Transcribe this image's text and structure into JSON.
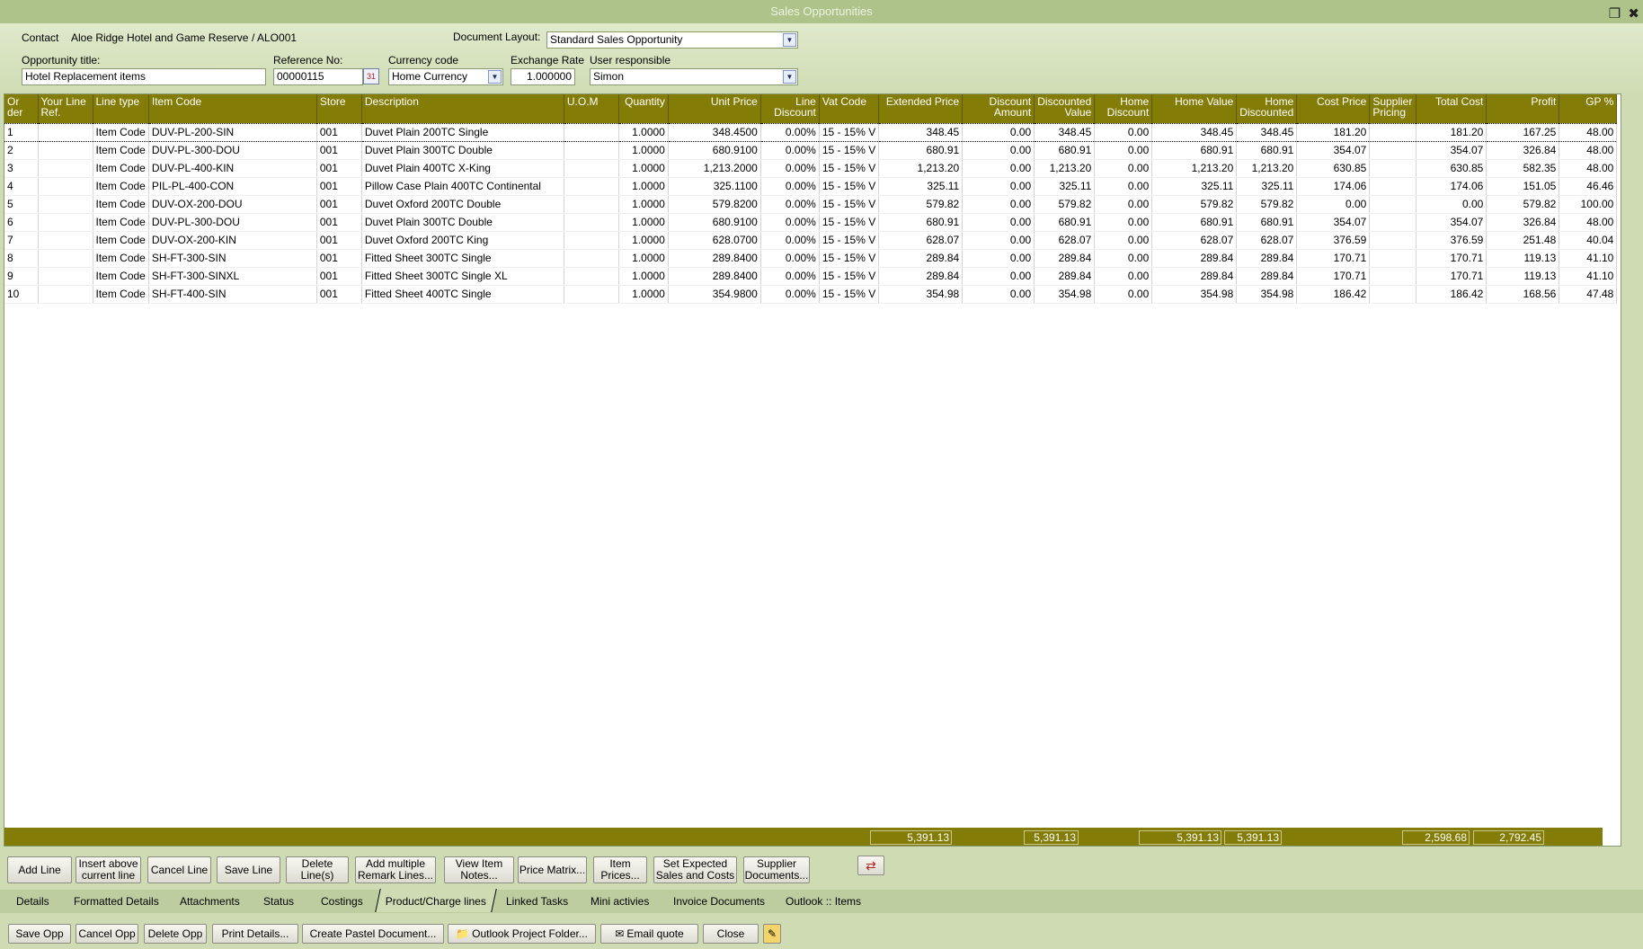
{
  "window": {
    "title": "Sales Opportunities",
    "restore_glyph": "❐",
    "close_glyph": "✖"
  },
  "header": {
    "contact_label": "Contact",
    "contact_name": "Aloe Ridge Hotel and Game Reserve",
    "contact_code": "/ ALO001",
    "document_layout_label": "Document Layout:",
    "document_layout_value": "Standard Sales Opportunity",
    "opportunity_title_label": "Opportunity title:",
    "opportunity_title_value": "Hotel Replacement items",
    "reference_label": "Reference No:",
    "reference_value": "00000115",
    "currency_label": "Currency code",
    "currency_value": "Home Currency",
    "exchange_rate_label": "Exchange Rate",
    "exchange_rate_value": "1.000000",
    "user_label": "User responsible",
    "user_value": "Simon"
  },
  "grid": {
    "columns": [
      {
        "label": "Or der",
        "align": "l"
      },
      {
        "label": "Your Line Ref.",
        "align": "l"
      },
      {
        "label": "Line type",
        "align": "l"
      },
      {
        "label": "Item Code",
        "align": "l"
      },
      {
        "label": "Store",
        "align": "l"
      },
      {
        "label": "Description",
        "align": "l"
      },
      {
        "label": "U.O.M",
        "align": "l"
      },
      {
        "label": "Quantity",
        "align": "r"
      },
      {
        "label": "Unit Price",
        "align": "r"
      },
      {
        "label": "Line Discount",
        "align": "r"
      },
      {
        "label": "Vat Code",
        "align": "l"
      },
      {
        "label": "Extended Price",
        "align": "r"
      },
      {
        "label": "Discount Amount",
        "align": "r"
      },
      {
        "label": "Discounted Value",
        "align": "r"
      },
      {
        "label": "Home Discount",
        "align": "r"
      },
      {
        "label": "Home Value",
        "align": "r"
      },
      {
        "label": "Home Discounted",
        "align": "r"
      },
      {
        "label": "Cost Price",
        "align": "r"
      },
      {
        "label": "Supplier Pricing",
        "align": "l"
      },
      {
        "label": "Total Cost",
        "align": "r"
      },
      {
        "label": "Profit",
        "align": "r"
      },
      {
        "label": "GP %",
        "align": "r"
      }
    ],
    "rows": [
      [
        "1",
        "",
        "Item Code",
        "DUV-PL-200-SIN",
        "001",
        "Duvet Plain 200TC Single",
        "",
        "1.0000",
        "348.4500",
        "0.00%",
        "15 - 15% V",
        "348.45",
        "0.00",
        "348.45",
        "0.00",
        "348.45",
        "348.45",
        "181.20",
        "",
        "181.20",
        "167.25",
        "48.00"
      ],
      [
        "2",
        "",
        "Item Code",
        "DUV-PL-300-DOU",
        "001",
        "Duvet Plain 300TC Double",
        "",
        "1.0000",
        "680.9100",
        "0.00%",
        "15 - 15% V",
        "680.91",
        "0.00",
        "680.91",
        "0.00",
        "680.91",
        "680.91",
        "354.07",
        "",
        "354.07",
        "326.84",
        "48.00"
      ],
      [
        "3",
        "",
        "Item Code",
        "DUV-PL-400-KIN",
        "001",
        "Duvet Plain 400TC X-King",
        "",
        "1.0000",
        "1,213.2000",
        "0.00%",
        "15 - 15% V",
        "1,213.20",
        "0.00",
        "1,213.20",
        "0.00",
        "1,213.20",
        "1,213.20",
        "630.85",
        "",
        "630.85",
        "582.35",
        "48.00"
      ],
      [
        "4",
        "",
        "Item Code",
        "PIL-PL-400-CON",
        "001",
        "Pillow Case Plain 400TC Continental",
        "",
        "1.0000",
        "325.1100",
        "0.00%",
        "15 - 15% V",
        "325.11",
        "0.00",
        "325.11",
        "0.00",
        "325.11",
        "325.11",
        "174.06",
        "",
        "174.06",
        "151.05",
        "46.46"
      ],
      [
        "5",
        "",
        "Item Code",
        "DUV-OX-200-DOU",
        "001",
        "Duvet Oxford 200TC Double",
        "",
        "1.0000",
        "579.8200",
        "0.00%",
        "15 - 15% V",
        "579.82",
        "0.00",
        "579.82",
        "0.00",
        "579.82",
        "579.82",
        "0.00",
        "",
        "0.00",
        "579.82",
        "100.00"
      ],
      [
        "6",
        "",
        "Item Code",
        "DUV-PL-300-DOU",
        "001",
        "Duvet Plain 300TC Double",
        "",
        "1.0000",
        "680.9100",
        "0.00%",
        "15 - 15% V",
        "680.91",
        "0.00",
        "680.91",
        "0.00",
        "680.91",
        "680.91",
        "354.07",
        "",
        "354.07",
        "326.84",
        "48.00"
      ],
      [
        "7",
        "",
        "Item Code",
        "DUV-OX-200-KIN",
        "001",
        "Duvet Oxford 200TC King",
        "",
        "1.0000",
        "628.0700",
        "0.00%",
        "15 - 15% V",
        "628.07",
        "0.00",
        "628.07",
        "0.00",
        "628.07",
        "628.07",
        "376.59",
        "",
        "376.59",
        "251.48",
        "40.04"
      ],
      [
        "8",
        "",
        "Item Code",
        "SH-FT-300-SIN",
        "001",
        "Fitted Sheet 300TC Single",
        "",
        "1.0000",
        "289.8400",
        "0.00%",
        "15 - 15% V",
        "289.84",
        "0.00",
        "289.84",
        "0.00",
        "289.84",
        "289.84",
        "170.71",
        "",
        "170.71",
        "119.13",
        "41.10"
      ],
      [
        "9",
        "",
        "Item Code",
        "SH-FT-300-SINXL",
        "001",
        "Fitted Sheet 300TC Single XL",
        "",
        "1.0000",
        "289.8400",
        "0.00%",
        "15 - 15% V",
        "289.84",
        "0.00",
        "289.84",
        "0.00",
        "289.84",
        "289.84",
        "170.71",
        "",
        "170.71",
        "119.13",
        "41.10"
      ],
      [
        "10",
        "",
        "Item Code",
        "SH-FT-400-SIN",
        "001",
        "Fitted Sheet 400TC Single",
        "",
        "1.0000",
        "354.9800",
        "0.00%",
        "15 - 15% V",
        "354.98",
        "0.00",
        "354.98",
        "0.00",
        "354.98",
        "354.98",
        "186.42",
        "",
        "186.42",
        "168.56",
        "47.48"
      ]
    ],
    "totals": {
      "extended_price": "5,391.13",
      "discounted_value": "5,391.13",
      "home_value": "5,391.13",
      "home_discounted": "5,391.13",
      "total_cost": "2,598.68",
      "profit": "2,792.45"
    }
  },
  "line_buttons": [
    "Add Line",
    "Insert above current line",
    "Cancel Line",
    "Save Line",
    "Delete Line(s)",
    "Add multiple Remark Lines...",
    "View Item Notes...",
    "Price Matrix...",
    "Item Prices...",
    "Set Expected Sales and Costs",
    "Supplier Documents..."
  ],
  "tabs": [
    "Details",
    "Formatted Details",
    "Attachments",
    "Status",
    "Costings",
    "Product/Charge lines",
    "Linked Tasks",
    "Mini activies",
    "Invoice Documents",
    "Outlook :: Items"
  ],
  "active_tab": "Product/Charge lines",
  "bottom_buttons": [
    "Save Opp",
    "Cancel Opp",
    "Delete Opp",
    "Print Details...",
    "Create Pastel Document...",
    "Outlook Project Folder...",
    "Email quote",
    "Close"
  ],
  "icons": {
    "dropdown": "▼",
    "calendar": "31",
    "folder": "📁",
    "email": "✉",
    "note": "✎",
    "export": "⇄"
  },
  "colors": {
    "grid_header": "#837c06",
    "background": "#cfdcb3",
    "titlebar": "#adc38a"
  }
}
